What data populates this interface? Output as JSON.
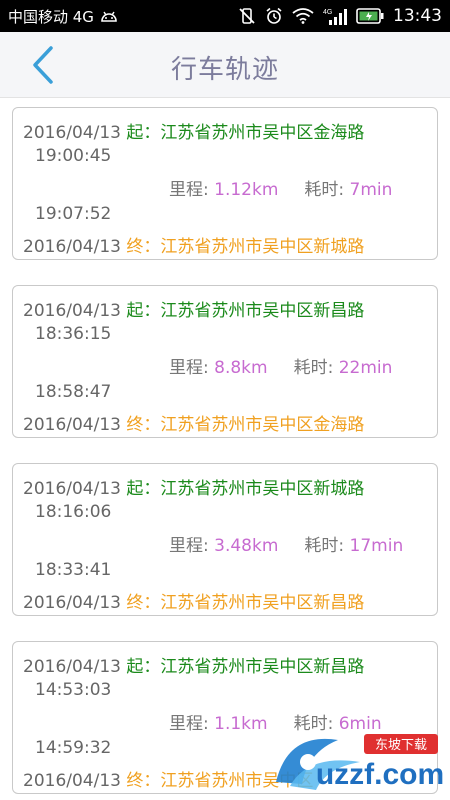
{
  "status_bar": {
    "carrier": "中国移动 4G",
    "network": "4G",
    "time": "13:43"
  },
  "header": {
    "title": "行车轨迹",
    "back_icon": "chevron-left-icon"
  },
  "labels": {
    "start_prefix": "起：",
    "end_prefix": "终：",
    "distance_label": "里程: ",
    "duration_label": "耗时: "
  },
  "trips": [
    {
      "date_start": "2016/04/13",
      "start_place": "江苏省苏州市吴中区金海路",
      "time_start": "19:00:45",
      "distance": "1.12km",
      "duration": "7min",
      "time_end": "19:07:52",
      "date_end": "2016/04/13",
      "end_place": "江苏省苏州市吴中区新城路"
    },
    {
      "date_start": "2016/04/13",
      "start_place": "江苏省苏州市吴中区新昌路",
      "time_start": "18:36:15",
      "distance": "8.8km",
      "duration": "22min",
      "time_end": "18:58:47",
      "date_end": "2016/04/13",
      "end_place": "江苏省苏州市吴中区金海路"
    },
    {
      "date_start": "2016/04/13",
      "start_place": "江苏省苏州市吴中区新城路",
      "time_start": "18:16:06",
      "distance": "3.48km",
      "duration": "17min",
      "time_end": "18:33:41",
      "date_end": "2016/04/13",
      "end_place": "江苏省苏州市吴中区新昌路"
    },
    {
      "date_start": "2016/04/13",
      "start_place": "江苏省苏州市吴中区新昌路",
      "time_start": "14:53:03",
      "distance": "1.1km",
      "duration": "6min",
      "time_end": "14:59:32",
      "date_end": "2016/04/13",
      "end_place": "江苏省苏州市吴中区"
    }
  ],
  "watermark": {
    "site": "uzzf.com",
    "tag": "东坡下载"
  },
  "colors": {
    "start": "#1b8a1b",
    "end": "#f0a020",
    "value": "#c76bd0",
    "back_arrow": "#3a9fd8",
    "title": "#7c7c9c"
  }
}
